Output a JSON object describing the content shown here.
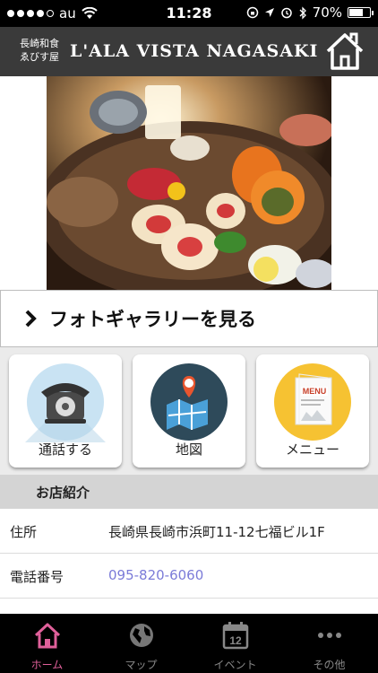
{
  "status_bar": {
    "carrier": "au",
    "time": "11:28",
    "battery": "70%",
    "battery_level": 0.7
  },
  "header": {
    "brand_small": "長崎和食 ゑびす屋",
    "title": "L'ALA VISTA NAGASAKI"
  },
  "gallery": {
    "label": "フォトギャラリーを見る"
  },
  "actions": [
    {
      "label": "通話する",
      "icon": "telephone-icon"
    },
    {
      "label": "地図",
      "icon": "map-icon"
    },
    {
      "label": "メニュー",
      "icon": "menu-icon"
    }
  ],
  "menu_icon_text": "MENU",
  "info": {
    "section_title": "お店紹介",
    "rows": [
      {
        "key": "住所",
        "value": "長崎県長崎市浜町11-12七福ビル1F"
      },
      {
        "key": "電話番号",
        "value": "095-820-6060"
      }
    ]
  },
  "tab_bar": {
    "calendar_day": "12",
    "items": [
      {
        "label": "ホーム",
        "icon": "home-icon"
      },
      {
        "label": "マップ",
        "icon": "globe-icon"
      },
      {
        "label": "イベント",
        "icon": "calendar-icon"
      },
      {
        "label": "その他",
        "icon": "more-icon"
      }
    ]
  },
  "colors": {
    "header_bg": "#3a3a3a",
    "accent_pink": "#e0609a",
    "phone_link": "#7b7bd8",
    "section_bg": "#d4d4d4"
  }
}
